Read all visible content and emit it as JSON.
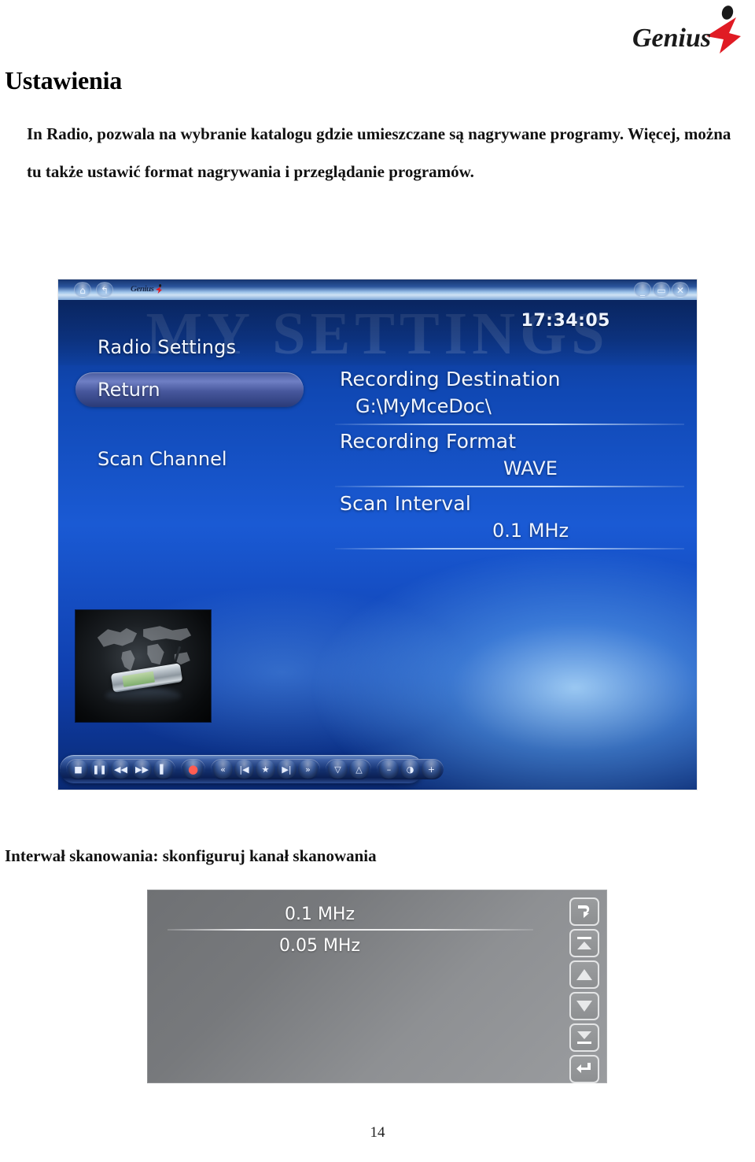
{
  "document": {
    "title": "Ustawienia",
    "paragraph": "In Radio, pozwala na wybranie katalogu gdzie umieszczane są nagrywane programy. Więcej, można tu także ustawić format nagrywania i przeglądanie programów.",
    "caption": "Interwał skanowania: skonfiguruj kanał skanowania",
    "page_number": "14"
  },
  "brand": {
    "name": "Genius",
    "mark_color": "#E01B24",
    "text_color": "#1A1A1A"
  },
  "screenshot": {
    "titlebar": {
      "home_icon": "home-icon",
      "back_icon": "back-arrow-icon",
      "logo_text": "Genius",
      "minimize_icon": "minimize-icon",
      "maximize_icon": "maximize-icon",
      "close_icon": "close-icon",
      "close_glyph": "✕",
      "maximize_glyph": "▭",
      "minimize_glyph": ""
    },
    "watermark": "MY SETTINGS",
    "clock": "17:34:05",
    "section_title": "Radio Settings",
    "menu": [
      {
        "label": "Return",
        "selected": true
      },
      {
        "label": "Scan Channel",
        "selected": false
      }
    ],
    "settings": [
      {
        "label": "Recording Destination",
        "value": "G:\\MyMceDoc\\",
        "indent": "indent-1"
      },
      {
        "label": "Recording Format",
        "value": "WAVE",
        "indent": "indent-2"
      },
      {
        "label": "Scan Interval",
        "value": "0.1 MHz",
        "indent": "indent-3"
      }
    ],
    "thumbnail": {
      "name": "radio-device-thumbnail",
      "alt": "FM radio device over world map"
    },
    "transport": {
      "groups": [
        {
          "buttons": [
            {
              "name": "stop-button",
              "glyph": "■"
            },
            {
              "name": "pause-button",
              "glyph": "❚❚"
            },
            {
              "name": "rewind-button",
              "glyph": "◀◀"
            },
            {
              "name": "fast-forward-button",
              "glyph": "▶▶"
            },
            {
              "name": "skip-end-button",
              "glyph": "▌"
            }
          ]
        },
        {
          "buttons": [
            {
              "name": "record-button",
              "glyph": "●"
            }
          ]
        },
        {
          "buttons": [
            {
              "name": "prev-fast-button",
              "glyph": "«"
            },
            {
              "name": "previous-track-button",
              "glyph": "|◀"
            },
            {
              "name": "favorite-button",
              "glyph": "★"
            },
            {
              "name": "next-track-button",
              "glyph": "▶|"
            },
            {
              "name": "next-fast-button",
              "glyph": "»"
            }
          ]
        },
        {
          "buttons": [
            {
              "name": "channel-down-button",
              "glyph": "▽"
            },
            {
              "name": "channel-up-button",
              "glyph": "△"
            }
          ]
        },
        {
          "buttons": [
            {
              "name": "volume-down-button",
              "glyph": "–"
            },
            {
              "name": "mute-button",
              "glyph": "◑"
            },
            {
              "name": "volume-up-button",
              "glyph": "+"
            }
          ]
        }
      ]
    }
  },
  "scan_interval_dialog": {
    "options": [
      {
        "label": "0.1 MHz",
        "selected": true
      },
      {
        "label": "0.05 MHz",
        "selected": false
      }
    ],
    "nav_buttons": [
      {
        "name": "back-arrow-button",
        "icon": "curved-back-arrow-icon"
      },
      {
        "name": "page-up-button",
        "icon": "page-up-icon"
      },
      {
        "name": "scroll-up-button",
        "icon": "up-triangle-icon"
      },
      {
        "name": "scroll-down-button",
        "icon": "down-triangle-icon"
      },
      {
        "name": "page-down-button",
        "icon": "page-down-icon"
      },
      {
        "name": "enter-button",
        "icon": "enter-arrow-icon"
      }
    ]
  }
}
